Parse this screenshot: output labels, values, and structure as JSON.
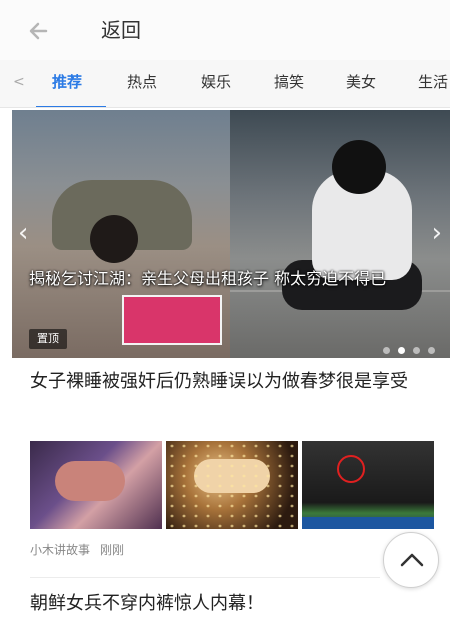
{
  "header": {
    "back_label": "返回"
  },
  "tabs": {
    "items": [
      "推荐",
      "热点",
      "娱乐",
      "搞笑",
      "美女",
      "生活"
    ],
    "active_index": 0,
    "prev_symbol": "<"
  },
  "carousel": {
    "caption": "揭秘乞讨江湖：亲生父母出租孩子 称太穷迫不得已",
    "badge": "置顶",
    "slide_count": 4,
    "active_slide": 1,
    "prev_icon": "chevron-left-icon",
    "next_icon": "chevron-right-icon"
  },
  "articles": [
    {
      "title": "女子裸睡被强奸后仍熟睡误以为做春梦很是享受",
      "source": "小木讲故事",
      "time": "刚刚",
      "thumbnail_count": 3
    },
    {
      "title": "朝鲜女兵不穿内裤惊人内幕！"
    }
  ],
  "fab": {
    "icon": "chevron-up-icon"
  },
  "colors": {
    "accent": "#2c7be5",
    "badge_bg": "#000000"
  }
}
